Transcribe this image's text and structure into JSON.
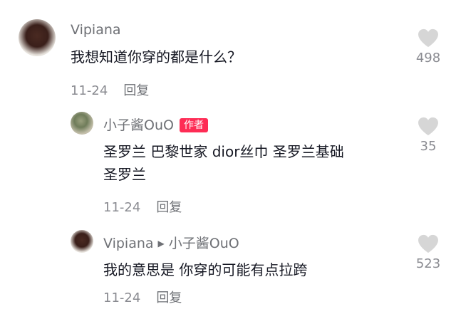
{
  "comments": [
    {
      "username": "Vipiana",
      "text": "我想知道你穿的都是什么？",
      "date": "11-24",
      "reply_label": "回复",
      "likes": "498"
    },
    {
      "username": "小子酱OuO",
      "badge": "作者",
      "text_line1": "圣罗兰 巴黎世家 dior丝巾 圣罗兰基础",
      "text_line2": "圣罗兰",
      "date": "11-24",
      "reply_label": "回复",
      "likes": "35"
    },
    {
      "username": "Vipiana",
      "reply_to": "小子酱OuO",
      "text": "我的意思是 你穿的可能有点拉跨",
      "date": "11-24",
      "reply_label": "回复",
      "likes": "523"
    }
  ],
  "icons": {
    "like": "heart-icon",
    "reply_arrow": "triangle-right-icon"
  },
  "colors": {
    "badge": "#fe2c55",
    "heart": "#d6d6d6"
  }
}
